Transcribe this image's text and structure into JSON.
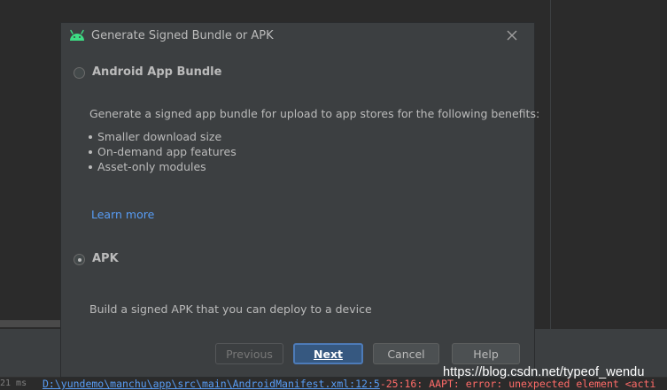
{
  "dialog": {
    "title": "Generate Signed Bundle or APK",
    "options": {
      "bundle": {
        "label": "Android App Bundle",
        "selected": false,
        "description": "Generate a signed app bundle for upload to app stores for the following benefits:",
        "benefits": [
          "Smaller download size",
          "On-demand app features",
          "Asset-only modules"
        ],
        "learn_more": "Learn more"
      },
      "apk": {
        "label": "APK",
        "selected": true,
        "description": "Build a signed APK that you can deploy to a device"
      }
    },
    "buttons": {
      "previous": "Previous",
      "next": "Next",
      "cancel": "Cancel",
      "help": "Help"
    }
  },
  "status": {
    "time": "21 ms",
    "path": "D:\\yundemo\\manchu\\app\\src\\main\\AndroidManifest.xml:12:5",
    "message": "-25:16: AAPT: error: unexpected element <acti"
  },
  "watermark": "https://blog.csdn.net/typeof_wendu",
  "colors": {
    "dialog_bg": "#3c3f41",
    "ide_bg": "#2b2b2b",
    "link": "#589df6",
    "error": "#ff6b68",
    "default_button": "#365880",
    "android_green": "#3ddc84"
  },
  "icons": {
    "title": "android-icon",
    "close": "close-icon"
  }
}
